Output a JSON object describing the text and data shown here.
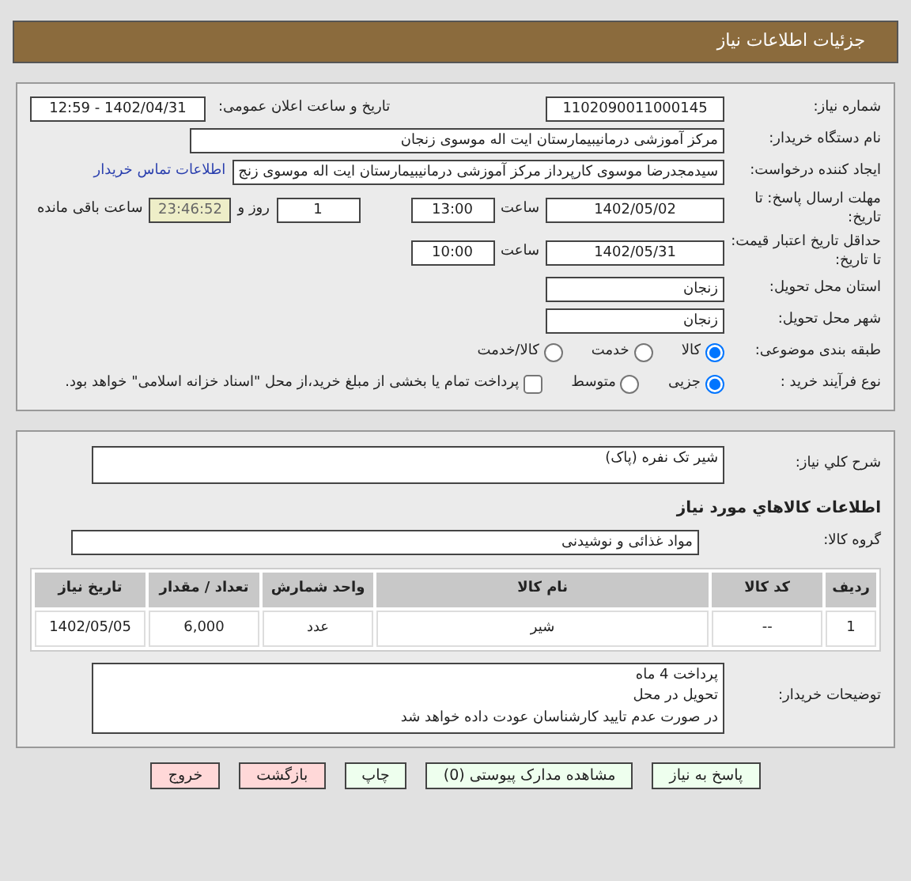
{
  "header": {
    "title": "جزئیات اطلاعات نیاز"
  },
  "details": {
    "need_number": {
      "label": "شماره نیاز:",
      "value": "1102090011000145"
    },
    "announce": {
      "label": "تاریخ و ساعت اعلان عمومی:",
      "value": "1402/04/31 - 12:59"
    },
    "buyer_org": {
      "label": "نام دستگاه خریدار:",
      "value": "مرکز آموزشی درمانیبیمارستان ایت اله موسوی زنجان"
    },
    "creator": {
      "label": "ایجاد کننده درخواست:",
      "value": "سیدمجدرضا موسوی کارپرداز مرکز آموزشی درمانیبیمارستان ایت اله موسوی زنج",
      "link": "اطلاعات تماس خریدار"
    },
    "deadline": {
      "label": "مهلت ارسال پاسخ: تا تاریخ:",
      "date": "1402/05/02",
      "time_label": "ساعت",
      "time": "13:00",
      "days": "1",
      "days_label": "روز و",
      "remaining": "23:46:52",
      "remaining_label": "ساعت باقی مانده"
    },
    "validity": {
      "label": "حداقل تاریخ اعتبار قیمت: تا تاریخ:",
      "date": "1402/05/31",
      "time_label": "ساعت",
      "time": "10:00"
    },
    "province": {
      "label": "استان محل تحویل:",
      "value": "زنجان"
    },
    "city": {
      "label": "شهر محل تحویل:",
      "value": "زنجان"
    },
    "category": {
      "label": "طبقه بندی موضوعی:",
      "options": [
        {
          "label": "کالا",
          "selected": true
        },
        {
          "label": "خدمت",
          "selected": false
        },
        {
          "label": "کالا/خدمت",
          "selected": false
        }
      ]
    },
    "process": {
      "label": "نوع فرآیند خرید :",
      "options": [
        {
          "label": "جزیی",
          "selected": true
        },
        {
          "label": "متوسط",
          "selected": false
        }
      ],
      "treasury": {
        "label": "پرداخت تمام یا بخشی از مبلغ خرید،از محل \"اسناد خزانه اسلامی\" خواهد بود.",
        "checked": false
      }
    }
  },
  "needs": {
    "summary": {
      "label": "شرح کلي نیاز:",
      "value": "شیر تک نفره (پاک)"
    },
    "goods_heading": "اطلاعات کالاهاي مورد نیاز",
    "group": {
      "label": "گروه کالا:",
      "value": "مواد غذائی و نوشیدنی"
    },
    "table": {
      "columns": [
        "ردیف",
        "کد کالا",
        "نام کالا",
        "واحد شمارش",
        "تعداد / مقدار",
        "تاریخ نیاز"
      ],
      "rows": [
        [
          "1",
          "--",
          "شیر",
          "عدد",
          "6,000",
          "1402/05/05"
        ]
      ]
    },
    "buyer_notes": {
      "label": "توضیحات خریدار:",
      "lines": [
        "پرداخت 4 ماه",
        "تحویل در محل",
        "در صورت عدم تایید کارشناسان عودت داده خواهد شد"
      ]
    }
  },
  "buttons": [
    {
      "label": "پاسخ به نیاز",
      "kind": "action"
    },
    {
      "label": "مشاهده مدارک پیوستی (0)",
      "kind": "action"
    },
    {
      "label": "چاپ",
      "kind": "action"
    },
    {
      "label": "بازگشت",
      "kind": "exit"
    },
    {
      "label": "خروج",
      "kind": "exit"
    }
  ]
}
